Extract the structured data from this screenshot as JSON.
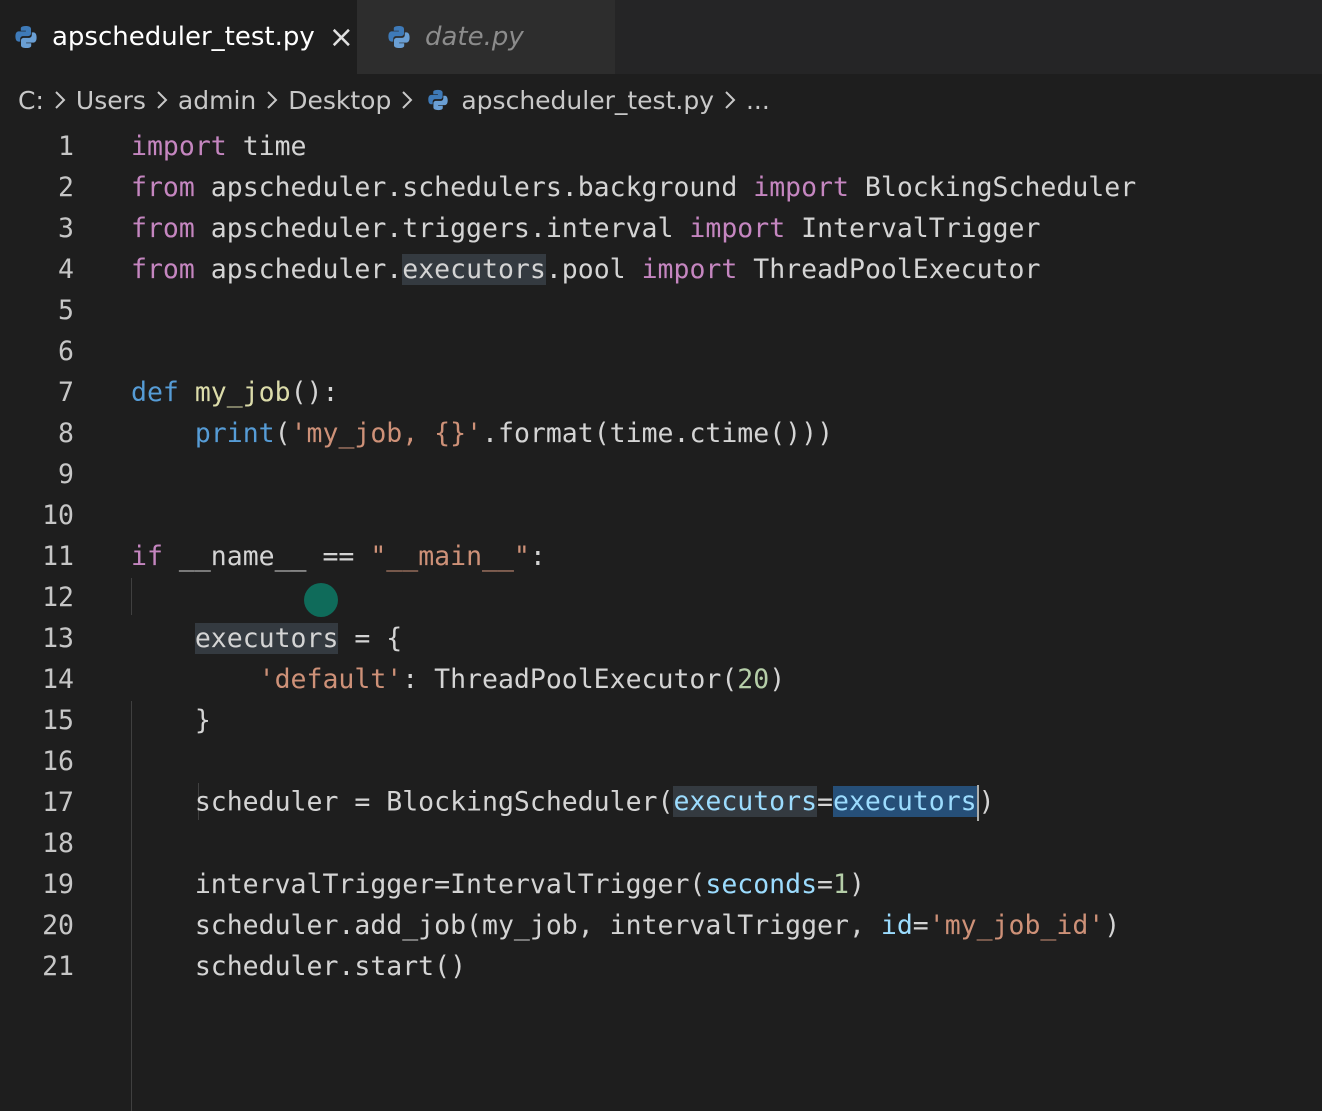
{
  "tabs": [
    {
      "label": "apscheduler_test.py",
      "close": "×"
    },
    {
      "label": "date.py"
    }
  ],
  "breadcrumb": {
    "drive": "C:",
    "users": "Users",
    "admin": "admin",
    "desktop": "Desktop",
    "file": "apscheduler_test.py",
    "more": "..."
  },
  "editor": {
    "line_numbers": [
      "1",
      "2",
      "3",
      "4",
      "5",
      "6",
      "7",
      "8",
      "9",
      "10",
      "11",
      "12",
      "13",
      "14",
      "15",
      "16",
      "17",
      "18",
      "19",
      "20",
      "21"
    ],
    "code": {
      "l1": [
        "import",
        " time"
      ],
      "l2": [
        "from",
        " apscheduler.schedulers.background ",
        "import",
        " BlockingScheduler"
      ],
      "l3": [
        "from",
        " apscheduler.triggers.interval ",
        "import",
        " IntervalTrigger"
      ],
      "l4": [
        "from",
        " apscheduler.",
        "executors",
        ".pool ",
        "import",
        " ThreadPoolExecutor"
      ],
      "l7": [
        "def",
        " ",
        "my_job",
        "():"
      ],
      "l8": [
        "    ",
        "print",
        "(",
        "'my_job, {}'",
        ".format(time.ctime()))"
      ],
      "l11": [
        "if",
        " __name__ == ",
        "\"__main__\"",
        ":"
      ],
      "l13": [
        "    ",
        "executors",
        " = {"
      ],
      "l14": [
        "        ",
        "'default'",
        ": ThreadPoolExecutor(",
        "20",
        ")"
      ],
      "l15": [
        "    }"
      ],
      "l17": [
        "    scheduler = BlockingScheduler(",
        "executors",
        "=",
        "executors",
        ")"
      ],
      "l19": [
        "    intervalTrigger=IntervalTrigger(",
        "seconds",
        "=",
        "1",
        ")"
      ],
      "l20": [
        "    scheduler.add_job(my_job, intervalTrigger, ",
        "id",
        "=",
        "'my_job_id'",
        ")"
      ],
      "l21": [
        "    scheduler.start()"
      ]
    }
  },
  "colors": {
    "background": "#1e1e1e",
    "keyword": "#c586c0",
    "def_keyword": "#569cd6",
    "string": "#ce9178",
    "number": "#b5cea8",
    "parameter": "#9cdcfe",
    "selection": "#264f78"
  },
  "icons": {
    "file_icon": "python-icon",
    "close_icon": "close-icon",
    "separator_icon": "chevron-right-icon"
  }
}
